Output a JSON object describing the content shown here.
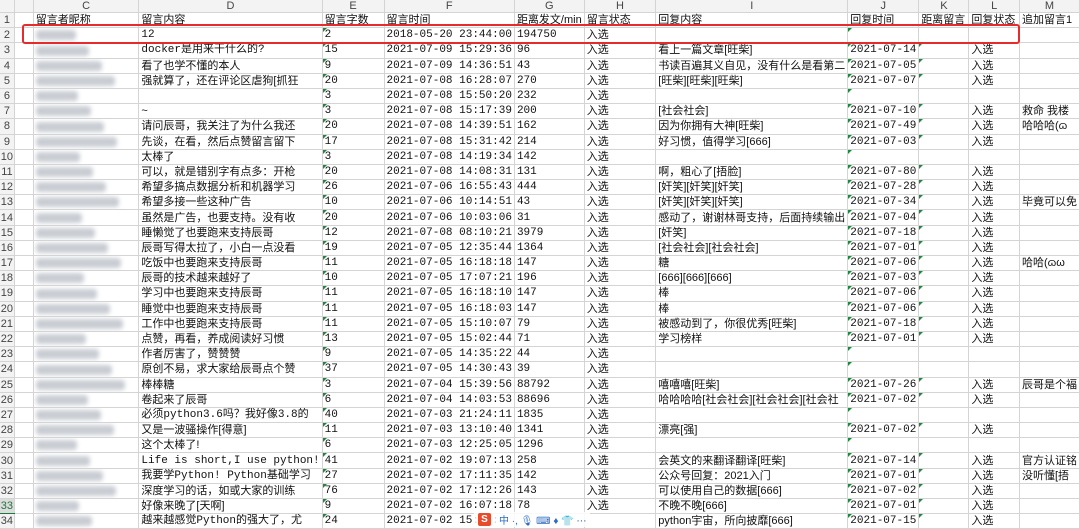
{
  "columns": [
    "C",
    "D",
    "E",
    "F",
    "G",
    "H",
    "I",
    "J",
    "K",
    "L",
    "M"
  ],
  "headers": [
    "留言者昵称",
    "留言内容",
    "留言字数",
    "留言时间",
    "距离发文/min",
    "留言状态",
    "回复内容",
    "回复时间",
    "距离留言",
    "回复状态",
    "追加留言1"
  ],
  "rows": [
    {
      "n": "2",
      "d": "12",
      "e": "2",
      "f": "2018-05-20 23:44:00",
      "g": "194750",
      "h": "入选",
      "i": "",
      "j": "",
      "l": "",
      "m": ""
    },
    {
      "n": "3",
      "d": "docker是用来干什么的?",
      "e": "15",
      "f": "2021-07-09 15:29:36",
      "g": "96",
      "h": "入选",
      "i": "看上一篇文章[旺柴]",
      "j": "2021-07-14",
      "l": "入选",
      "m": ""
    },
    {
      "n": "4",
      "d": "看了也学不懂的本人",
      "e": "9",
      "f": "2021-07-09 14:36:51",
      "g": "43",
      "h": "入选",
      "i": "书读百遍其义自见，没有什么是看第二",
      "j": "2021-07-05",
      "l": "入选",
      "m": ""
    },
    {
      "n": "5",
      "d": "强就算了，还在评论区虐狗[抓狂",
      "e": "20",
      "f": "2021-07-08 16:28:07",
      "g": "270",
      "h": "入选",
      "i": "[旺柴][旺柴][旺柴]",
      "j": "2021-07-07",
      "l": "入选",
      "m": ""
    },
    {
      "n": "6",
      "d": "",
      "e": "3",
      "f": "2021-07-08 15:50:20",
      "g": "232",
      "h": "入选",
      "i": "",
      "j": "",
      "l": "",
      "m": ""
    },
    {
      "n": "7",
      "d": "~",
      "e": "3",
      "f": "2021-07-08 15:17:39",
      "g": "200",
      "h": "入选",
      "i": "[社会社会]",
      "j": "2021-07-10",
      "l": "入选",
      "m": "救命 我楼"
    },
    {
      "n": "8",
      "d": "请问辰哥，我关注了为什么我还",
      "e": "20",
      "f": "2021-07-08 14:39:51",
      "g": "162",
      "h": "入选",
      "i": "因为你拥有大神[旺柴]",
      "j": "2021-07-49",
      "l": "入选",
      "m": "哈哈哈(ɷ"
    },
    {
      "n": "9",
      "d": "先谈，在看，然后点赞留言留下",
      "e": "17",
      "f": "2021-07-08 15:31:42",
      "g": "214",
      "h": "入选",
      "i": "好习惯，值得学习[666]",
      "j": "2021-07-03",
      "l": "入选",
      "m": ""
    },
    {
      "n": "10",
      "d": "太棒了",
      "e": "3",
      "f": "2021-07-08 14:19:34",
      "g": "142",
      "h": "入选",
      "i": "",
      "j": "",
      "l": "",
      "m": ""
    },
    {
      "n": "11",
      "d": "可以，就是错别字有点多：开枪",
      "e": "20",
      "f": "2021-07-08 14:08:31",
      "g": "131",
      "h": "入选",
      "i": "啊，粗心了[捂脸]",
      "j": "2021-07-80",
      "l": "入选",
      "m": ""
    },
    {
      "n": "12",
      "d": "希望多搞点数据分析和机器学习",
      "e": "26",
      "f": "2021-07-06 16:55:43",
      "g": "444",
      "h": "入选",
      "i": "[奸笑][奸笑][奸笑]",
      "j": "2021-07-28",
      "l": "入选",
      "m": ""
    },
    {
      "n": "13",
      "d": "希望多接一些这种广告",
      "e": "10",
      "f": "2021-07-06 10:14:51",
      "g": "43",
      "h": "入选",
      "i": "[奸笑][奸笑][奸笑]",
      "j": "2021-07-34",
      "l": "入选",
      "m": "毕竟可以免"
    },
    {
      "n": "14",
      "d": "虽然是广告，也要支持。没有收",
      "e": "20",
      "f": "2021-07-06 10:03:06",
      "g": "31",
      "h": "入选",
      "i": "感动了，谢谢林哥支持，后面持续输出",
      "j": "2021-07-04",
      "l": "入选",
      "m": ""
    },
    {
      "n": "15",
      "d": "睡懒觉了也要跑来支持辰哥",
      "e": "12",
      "f": "2021-07-08 08:10:21",
      "g": "3979",
      "h": "入选",
      "i": "[奸笑]",
      "j": "2021-07-18",
      "l": "入选",
      "m": ""
    },
    {
      "n": "16",
      "d": "辰哥写得太拉了，小白一点没看",
      "e": "19",
      "f": "2021-07-05 12:35:44",
      "g": "1364",
      "h": "入选",
      "i": "[社会社会][社会社会]",
      "j": "2021-07-01",
      "l": "入选",
      "m": ""
    },
    {
      "n": "17",
      "d": "吃饭中也要跑来支持辰哥",
      "e": "11",
      "f": "2021-07-05 16:18:18",
      "g": "147",
      "h": "入选",
      "i": "糖",
      "j": "2021-07-06",
      "l": "入选",
      "m": "哈哈(ɷω"
    },
    {
      "n": "18",
      "d": "辰哥的技术越来越好了",
      "e": "10",
      "f": "2021-07-05 17:07:21",
      "g": "196",
      "h": "入选",
      "i": "[666][666][666]",
      "j": "2021-07-03",
      "l": "入选",
      "m": ""
    },
    {
      "n": "19",
      "d": "学习中也要跑来支持辰哥",
      "e": "11",
      "f": "2021-07-05 16:18:10",
      "g": "147",
      "h": "入选",
      "i": "棒",
      "j": "2021-07-06",
      "l": "入选",
      "m": ""
    },
    {
      "n": "20",
      "d": "睡觉中也要跑来支持辰哥",
      "e": "11",
      "f": "2021-07-05 16:18:03",
      "g": "147",
      "h": "入选",
      "i": "棒",
      "j": "2021-07-06",
      "l": "入选",
      "m": ""
    },
    {
      "n": "21",
      "d": "工作中也要跑来支持辰哥",
      "e": "11",
      "f": "2021-07-05 15:10:07",
      "g": "79",
      "h": "入选",
      "i": "被感动到了，你很优秀[旺柴]",
      "j": "2021-07-18",
      "l": "入选",
      "m": ""
    },
    {
      "n": "22",
      "d": "点赞，再看，养成阅读好习惯",
      "e": "13",
      "f": "2021-07-05 15:02:44",
      "g": "71",
      "h": "入选",
      "i": "学习榜样",
      "j": "2021-07-01",
      "l": "入选",
      "m": ""
    },
    {
      "n": "23",
      "d": "作者厉害了，赞赞赞",
      "e": "9",
      "f": "2021-07-05 14:35:22",
      "g": "44",
      "h": "入选",
      "i": "",
      "j": "",
      "l": "",
      "m": ""
    },
    {
      "n": "24",
      "d": "原创不易，求大家给辰哥点个赞",
      "e": "37",
      "f": "2021-07-05 14:30:43",
      "g": "39",
      "h": "入选",
      "i": "",
      "j": "",
      "l": "",
      "m": ""
    },
    {
      "n": "25",
      "d": "棒棒糖",
      "e": "3",
      "f": "2021-07-04 15:39:56",
      "g": "88792",
      "h": "入选",
      "i": "嘻嘻嘻[旺柴]",
      "j": "2021-07-26",
      "l": "入选",
      "m": "辰哥是个褔"
    },
    {
      "n": "26",
      "d": "卷起来了辰哥",
      "e": "6",
      "f": "2021-07-04 14:03:53",
      "g": "88696",
      "h": "入选",
      "i": "哈哈哈哈[社会社会][社会社会][社会社",
      "j": "2021-07-02",
      "l": "入选",
      "m": ""
    },
    {
      "n": "27",
      "d": "必须python3.6吗？我好像3.8的",
      "e": "40",
      "f": "2021-07-03 21:24:11",
      "g": "1835",
      "h": "入选",
      "i": "",
      "j": "",
      "l": "",
      "m": ""
    },
    {
      "n": "28",
      "d": "又是一波骚操作[得意]",
      "e": "11",
      "f": "2021-07-03 13:10:40",
      "g": "1341",
      "h": "入选",
      "i": "漂亮[强]",
      "j": "2021-07-02",
      "l": "入选",
      "m": ""
    },
    {
      "n": "29",
      "d": "这个太棒了!",
      "e": "6",
      "f": "2021-07-03 12:25:05",
      "g": "1296",
      "h": "入选",
      "i": "",
      "j": "",
      "l": "",
      "m": ""
    },
    {
      "n": "30",
      "d": "Life is short,I use python!",
      "e": "41",
      "f": "2021-07-02 19:07:13",
      "g": "258",
      "h": "入选",
      "i": "会英文的来翻译翻译[旺柴]",
      "j": "2021-07-14",
      "l": "入选",
      "m": "官方认证铭"
    },
    {
      "n": "31",
      "d": "我要学Python! Python基础学习",
      "e": "27",
      "f": "2021-07-02 17:11:35",
      "g": "142",
      "h": "入选",
      "i": "公众号回复：2021入门",
      "j": "2021-07-01",
      "l": "入选",
      "m": "没听懂[捂"
    },
    {
      "n": "32",
      "d": "深度学习的话，如或大家的训练",
      "e": "76",
      "f": "2021-07-02 17:12:26",
      "g": "143",
      "h": "入选",
      "i": "可以使用自己的数据[666]",
      "j": "2021-07-02",
      "l": "入选",
      "m": ""
    },
    {
      "n": "33",
      "d": "好像来晚了[天啊]",
      "e": "9",
      "f": "2021-07-02 16:07:18",
      "g": "78",
      "h": "入选",
      "i": "不晚不晚[666]",
      "j": "2021-07-01",
      "l": "入选",
      "m": ""
    },
    {
      "n": "34",
      "d": "越来越感觉Python的强大了，尤",
      "e": "24",
      "f": "2021-07-02 15:38:",
      "g": "",
      "h": "",
      "i": "python宇宙，所向披靡[666]",
      "j": "2021-07-15",
      "l": "入选",
      "m": ""
    }
  ],
  "selected_row": "33",
  "watermark": {
    "badge": "S",
    "text": "中 ·, 🎙 ⌨ ♦ 👕 ⋯"
  }
}
